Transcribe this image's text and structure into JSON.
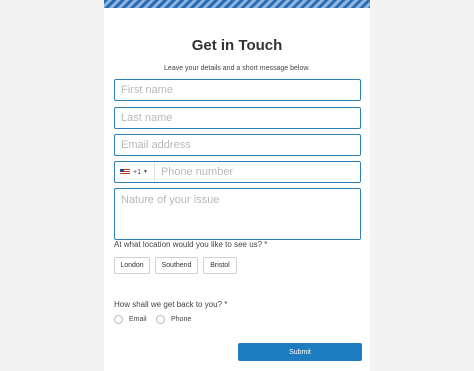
{
  "form": {
    "title": "Get in Touch",
    "subtitle": "Leave your details and a short message below.",
    "first_name": {
      "value": "",
      "placeholder": "First name"
    },
    "last_name": {
      "value": "",
      "placeholder": "Last name"
    },
    "email": {
      "value": "",
      "placeholder": "Email address"
    },
    "phone": {
      "country_flag": "us-flag-icon",
      "dial_code": "+1",
      "value": "",
      "placeholder": "Phone number"
    },
    "issue": {
      "value": "",
      "placeholder": "Nature of your issue"
    },
    "location_question": "At what location would you like to see us? *",
    "locations": [
      "London",
      "Southend",
      "Bristol"
    ],
    "contact_question": "How shall we get back to you? *",
    "contact_options": [
      "Email",
      "Phone"
    ],
    "submit_label": "Submit"
  },
  "colors": {
    "accent": "#1d7bbf",
    "field_border": "#2f7fb9",
    "background": "#f3f3f3"
  }
}
